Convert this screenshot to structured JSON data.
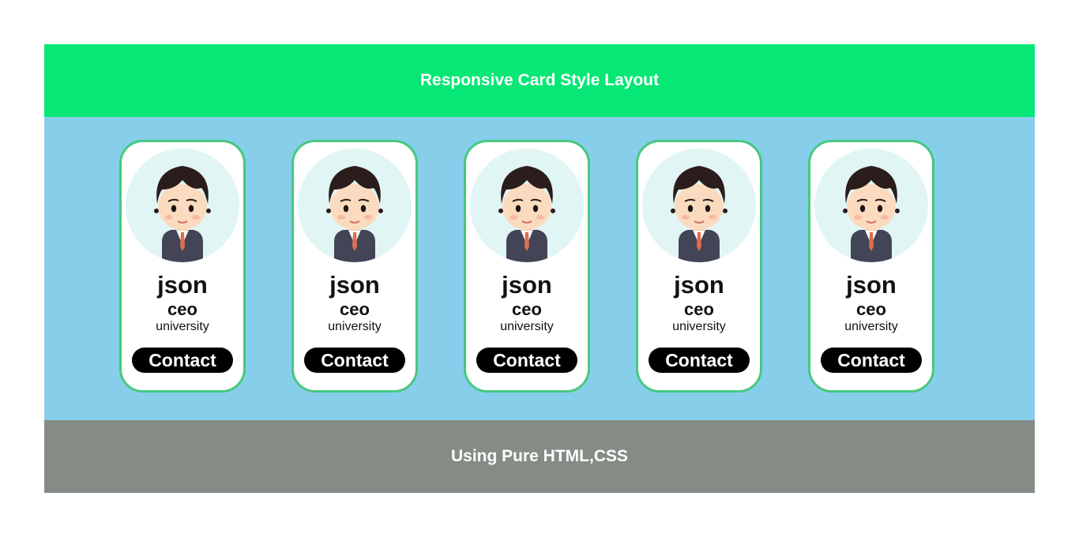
{
  "header": {
    "title": "Responsive Card Style Layout"
  },
  "cards": [
    {
      "name": "json",
      "role": "ceo",
      "org": "university",
      "button_label": "Contact",
      "avatar_icon": "businessman-avatar-icon"
    },
    {
      "name": "json",
      "role": "ceo",
      "org": "university",
      "button_label": "Contact",
      "avatar_icon": "businessman-avatar-icon"
    },
    {
      "name": "json",
      "role": "ceo",
      "org": "university",
      "button_label": "Contact",
      "avatar_icon": "businessman-avatar-icon"
    },
    {
      "name": "json",
      "role": "ceo",
      "org": "university",
      "button_label": "Contact",
      "avatar_icon": "businessman-avatar-icon"
    },
    {
      "name": "json",
      "role": "ceo",
      "org": "university",
      "button_label": "Contact",
      "avatar_icon": "businessman-avatar-icon"
    }
  ],
  "footer": {
    "text": "Using Pure HTML,CSS"
  },
  "colors": {
    "header_bg": "#06e776",
    "main_bg": "#87ceeb",
    "footer_bg": "#858c86",
    "card_border": "#47c87f",
    "button_bg": "#000000"
  }
}
